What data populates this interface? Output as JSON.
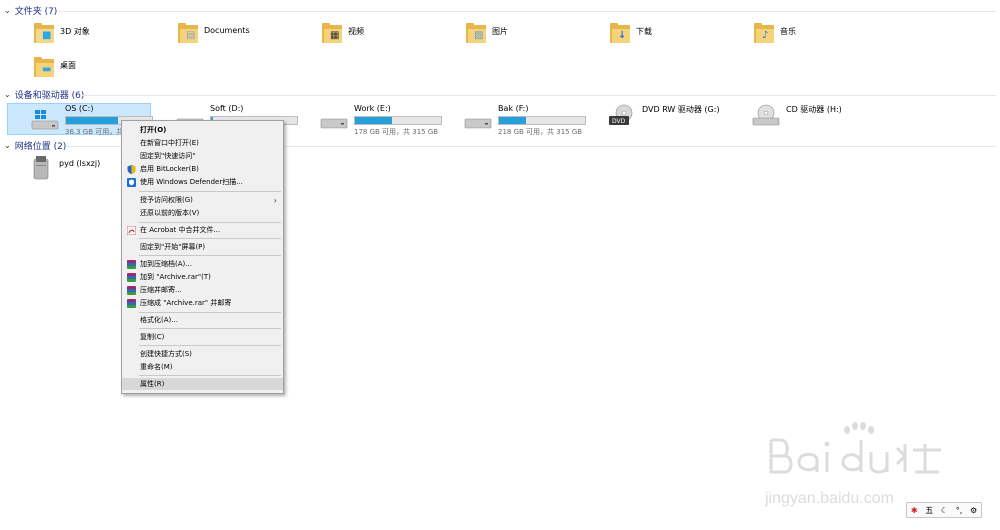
{
  "groups": {
    "folders_header": "文件夹 (7)",
    "drives_header": "设备和驱动器 (6)",
    "network_header": "网络位置 (2)"
  },
  "folders": [
    {
      "label": "3D 对象",
      "icon": "3d-objects-icon"
    },
    {
      "label": "Documents",
      "icon": "documents-icon"
    },
    {
      "label": "视频",
      "icon": "videos-icon"
    },
    {
      "label": "图片",
      "icon": "pictures-icon"
    },
    {
      "label": "下载",
      "icon": "downloads-icon"
    },
    {
      "label": "音乐",
      "icon": "music-icon"
    },
    {
      "label": "桌面",
      "icon": "desktop-icon"
    }
  ],
  "drives": [
    {
      "name": "OS (C:)",
      "sub": "36.3 GB 可用，共 9",
      "used_fraction": 0.6
    },
    {
      "name": "Soft (D:)",
      "sub": "",
      "used_fraction": 0.02
    },
    {
      "name": "Work (E:)",
      "sub": "178 GB 可用，共 315 GB",
      "used_fraction": 0.43
    },
    {
      "name": "Bak (F:)",
      "sub": "218 GB 可用，共 315 GB",
      "used_fraction": 0.31
    },
    {
      "name": "DVD RW 驱动器 (G:)",
      "sub": ""
    },
    {
      "name": "CD 驱动器 (H:)",
      "sub": ""
    }
  ],
  "network": [
    {
      "label": "pyd (lsxzj)"
    }
  ],
  "menu": {
    "open": "打开(O)",
    "open_new_window": "在新窗口中打开(E)",
    "pin_quick": "固定到\"快速访问\"",
    "bitlocker": "启用 BitLocker(B)",
    "defender": "使用 Windows Defender扫描...",
    "grant_access": "授予访问权限(G)",
    "restore": "还原以前的版本(V)",
    "acrobat": "在 Acrobat 中合并文件...",
    "pin_start": "固定到\"开始\"屏幕(P)",
    "rar_add": "加到压缩档(A)...",
    "rar_add_archive": "加到 \"Archive.rar\"(T)",
    "rar_email": "压缩并邮寄...",
    "rar_archive_email": "压缩成 \"Archive.rar\" 并邮寄",
    "format": "格式化(A)...",
    "copy": "复制(C)",
    "shortcut": "创建快捷方式(S)",
    "rename": "重命名(M)",
    "properties": "属性(R)"
  },
  "watermark": {
    "url": "jingyan.baidu.com"
  },
  "tray": {
    "ime": "五"
  },
  "colors": {
    "accent_bar": "#26a0da",
    "header_text": "#1e3287",
    "selection": "#cce8ff"
  }
}
